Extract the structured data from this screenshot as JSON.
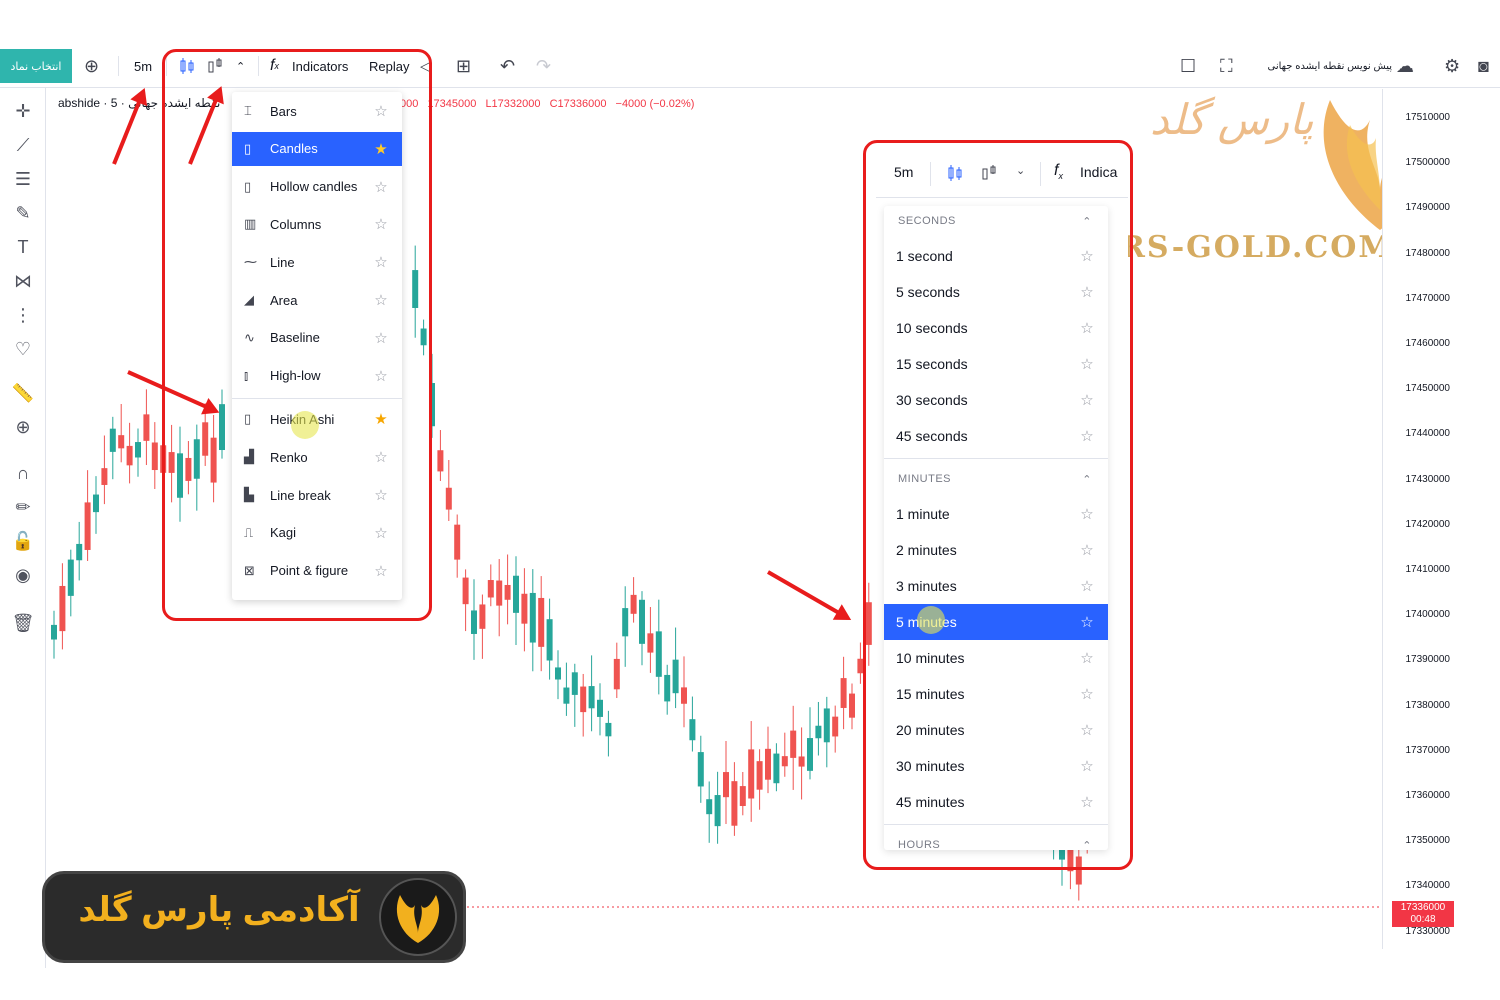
{
  "topbar": {
    "symbol_button": "انتخاب نماد",
    "interval": "5m",
    "indicators": "Indicators",
    "replay": "Replay",
    "publish_text": "پیش نویس نقطه ایشده جهانی",
    "icons": [
      "add-symbol-icon",
      "bar-style-icon",
      "heikin-ashi-icon",
      "chevron-up-icon",
      "function-icon",
      "replay-back-icon",
      "layout-icon",
      "undo-icon",
      "redo-icon",
      "fullscreen-square-icon",
      "fullscreen-icon",
      "cloud-icon",
      "settings-icon",
      "camera-icon"
    ]
  },
  "legend": {
    "title": "نقطه ایشده جهانی · 5 · abshide",
    "o": "000",
    "h": "17345000",
    "l": "L17332000",
    "c": "C17336000",
    "change": "−4000 (−0.02%)"
  },
  "chart_style_menu": {
    "items": [
      {
        "icon": "bars-icon",
        "label": "Bars",
        "favorite": false,
        "selected": false
      },
      {
        "icon": "candles-icon",
        "label": "Candles",
        "favorite": true,
        "selected": true
      },
      {
        "icon": "hollow-candles-icon",
        "label": "Hollow candles",
        "favorite": false,
        "selected": false
      },
      {
        "icon": "columns-icon",
        "label": "Columns",
        "favorite": false,
        "selected": false
      },
      {
        "icon": "line-icon",
        "label": "Line",
        "favorite": false,
        "selected": false
      },
      {
        "icon": "area-icon",
        "label": "Area",
        "favorite": false,
        "selected": false
      },
      {
        "icon": "baseline-icon",
        "label": "Baseline",
        "favorite": false,
        "selected": false
      },
      {
        "icon": "high-low-icon",
        "label": "High-low",
        "favorite": false,
        "selected": false
      },
      {
        "icon": "heikin-ashi-icon",
        "label": "Heikin Ashi",
        "favorite": true,
        "selected": false
      },
      {
        "icon": "renko-icon",
        "label": "Renko",
        "favorite": false,
        "selected": false
      },
      {
        "icon": "line-break-icon",
        "label": "Line break",
        "favorite": false,
        "selected": false
      },
      {
        "icon": "kagi-icon",
        "label": "Kagi",
        "favorite": false,
        "selected": false
      },
      {
        "icon": "point-figure-icon",
        "label": "Point & figure",
        "favorite": false,
        "selected": false
      }
    ]
  },
  "interval_panel": {
    "header_interval": "5m",
    "header_indicators": "Indica",
    "sections": [
      {
        "title": "SECONDS",
        "items": [
          "1 second",
          "5 seconds",
          "10 seconds",
          "15 seconds",
          "30 seconds",
          "45 seconds"
        ]
      },
      {
        "title": "MINUTES",
        "items": [
          "1 minute",
          "2 minutes",
          "3 minutes",
          "5 minutes",
          "10 minutes",
          "15 minutes",
          "20 minutes",
          "30 minutes",
          "45 minutes"
        ]
      },
      {
        "title": "HOURS",
        "items": []
      }
    ],
    "selected": "5 minutes"
  },
  "price_scale": {
    "ticks": [
      "17510000",
      "17500000",
      "17490000",
      "17480000",
      "17470000",
      "17460000",
      "17450000",
      "17440000",
      "17430000",
      "17420000",
      "17410000",
      "17400000",
      "17390000",
      "17380000",
      "17370000",
      "17360000",
      "17350000",
      "17340000",
      "17330000"
    ],
    "last_price": "17336000",
    "countdown": "00:48"
  },
  "watermark": {
    "site": "RS-GOLD.COM",
    "brand_fa": "پارس گلد"
  },
  "banner": {
    "text": "آکادمی پارس گلد"
  },
  "colors": {
    "up": "#26a69a",
    "down": "#ef5350",
    "accent": "#2962ff",
    "highlight_box": "#e81c1c",
    "symbol_button": "#2fb5ad",
    "gold": "#f2b01e"
  }
}
